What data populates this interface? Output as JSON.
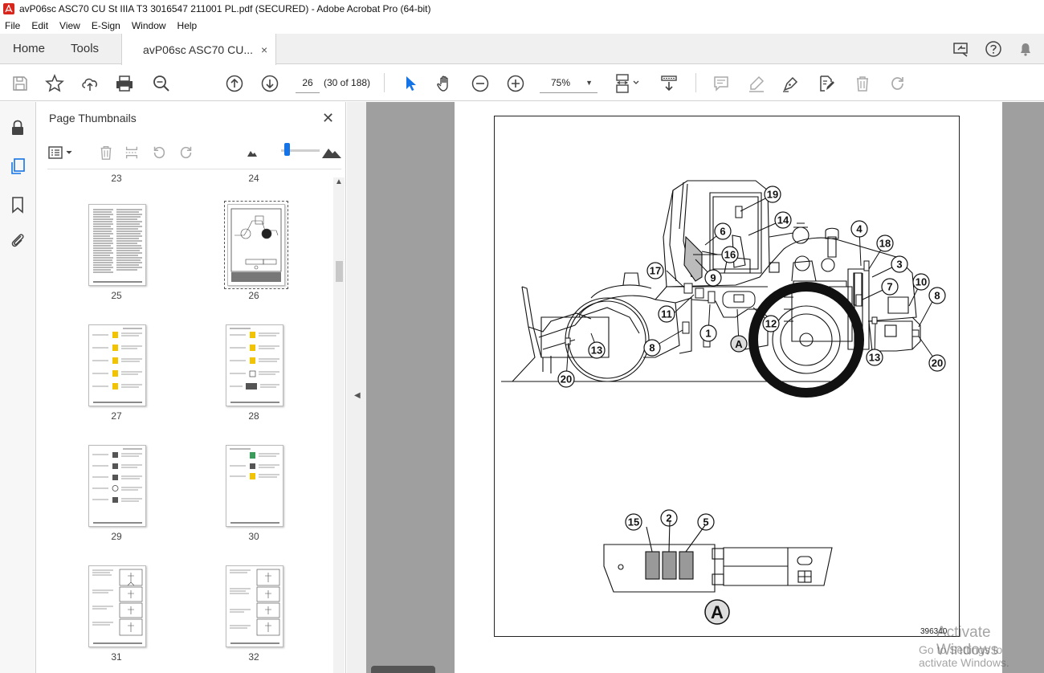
{
  "window": {
    "title": "avP06sc ASC70 CU St IIIA T3 3016547 211001 PL.pdf (SECURED) - Adobe Acrobat Pro (64-bit)"
  },
  "menu": [
    "File",
    "Edit",
    "View",
    "E-Sign",
    "Window",
    "Help"
  ],
  "tabs": {
    "home": "Home",
    "tools": "Tools",
    "document": "avP06sc ASC70 CU...",
    "close_glyph": "×"
  },
  "toolbar": {
    "page_number": "26",
    "page_count": "(30 of 188)",
    "zoom": "75%"
  },
  "thumbnails_panel": {
    "title": "Page Thumbnails",
    "close_glyph": "✕",
    "top_labels": [
      "23",
      "24"
    ],
    "pages": [
      {
        "label": "25",
        "selected": false
      },
      {
        "label": "26",
        "selected": true
      },
      {
        "label": "27",
        "selected": false
      },
      {
        "label": "28",
        "selected": false
      },
      {
        "label": "29",
        "selected": false
      },
      {
        "label": "30",
        "selected": false
      },
      {
        "label": "31",
        "selected": false
      },
      {
        "label": "32",
        "selected": false
      }
    ]
  },
  "document_page": {
    "callouts": [
      "1",
      "2",
      "3",
      "4",
      "5",
      "6",
      "7",
      "8",
      "8",
      "9",
      "10",
      "11",
      "12",
      "13",
      "13",
      "14",
      "15",
      "16",
      "17",
      "18",
      "19",
      "20",
      "20"
    ],
    "detail_label": "A",
    "detail_label_small": "A",
    "drawing_code": "396340"
  },
  "watermark": {
    "line1": "Activate Windows",
    "line2": "Go to Settings to activate Windows."
  }
}
